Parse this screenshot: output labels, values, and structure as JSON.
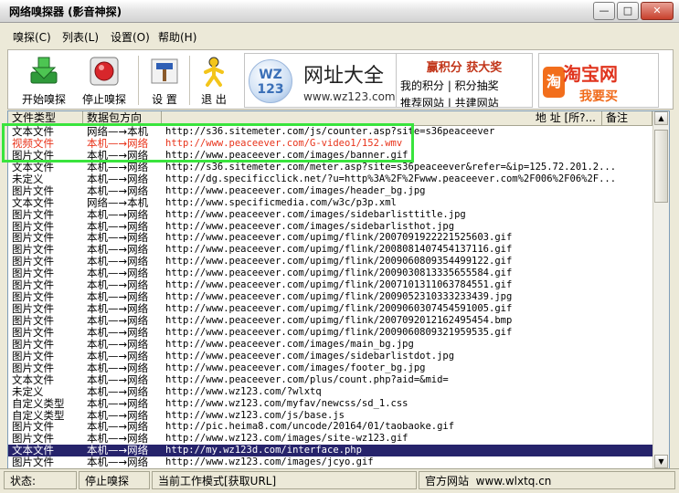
{
  "window": {
    "title": "网络嗅探器 (影音神探)"
  },
  "menu": [
    {
      "label": "嗅探(C)"
    },
    {
      "label": "列表(L)"
    },
    {
      "label": "设置(O)"
    },
    {
      "label": "帮助(H)"
    }
  ],
  "toolbar": {
    "start_label": "开始嗅探",
    "stop_label": "停止嗅探",
    "settings_label": "设 置",
    "exit_label": "退 出"
  },
  "ads": {
    "site_logo": "WZ 123",
    "site_title": "网址大全",
    "site_url": "www.wz123.com",
    "points_title": "赢积分 获大奖",
    "points_a": "我的积分  |  积分抽奖",
    "points_b": "推荐网站  |  共建网站",
    "taobao_icon": "淘",
    "taobao_title": "淘宝网",
    "taobao_sub": "我要买"
  },
  "table": {
    "headers": {
      "type": "文件类型",
      "direction": "数据包方向",
      "address": "地     址  [所?...",
      "note": "备注"
    },
    "rows": [
      {
        "type": "文本文件",
        "direction": "网络—→本机",
        "url": "http://s36.sitemeter.com/js/counter.asp?site=s36peaceever",
        "style": "normal"
      },
      {
        "type": "视频文件",
        "direction": "本机—→网络",
        "url": "http://www.peaceever.com/G-video1/152.wmv",
        "style": "red"
      },
      {
        "type": "图片文件",
        "direction": "本机—→网络",
        "url": "http://www.peaceever.com/images/banner.gif",
        "style": "normal"
      },
      {
        "type": "文本文件",
        "direction": "本机—→网络",
        "url": "http://s36.sitemeter.com/meter.asp?site=s36peaceever&refer=&ip=125.72.201.2...",
        "style": "normal"
      },
      {
        "type": "未定义",
        "direction": "本机—→网络",
        "url": "http://dg.specificclick.net/?u=http%3A%2F%2Fwww.peaceever.com%2F006%2F06%2F...",
        "style": "normal"
      },
      {
        "type": "图片文件",
        "direction": "本机—→网络",
        "url": "http://www.peaceever.com/images/header_bg.jpg",
        "style": "normal"
      },
      {
        "type": "文本文件",
        "direction": "网络—→本机",
        "url": "http://www.specificmedia.com/w3c/p3p.xml",
        "style": "normal"
      },
      {
        "type": "图片文件",
        "direction": "本机—→网络",
        "url": "http://www.peaceever.com/images/sidebarlisttitle.jpg",
        "style": "normal"
      },
      {
        "type": "图片文件",
        "direction": "本机—→网络",
        "url": "http://www.peaceever.com/images/sidebarlisthot.jpg",
        "style": "normal"
      },
      {
        "type": "图片文件",
        "direction": "本机—→网络",
        "url": "http://www.peaceever.com/upimg/flink/2007091922221525603.gif",
        "style": "normal"
      },
      {
        "type": "图片文件",
        "direction": "本机—→网络",
        "url": "http://www.peaceever.com/upimg/flink/2008081407454137116.gif",
        "style": "normal"
      },
      {
        "type": "图片文件",
        "direction": "本机—→网络",
        "url": "http://www.peaceever.com/upimg/flink/2009060809354499122.gif",
        "style": "normal"
      },
      {
        "type": "图片文件",
        "direction": "本机—→网络",
        "url": "http://www.peaceever.com/upimg/flink/2009030813335655584.gif",
        "style": "normal"
      },
      {
        "type": "图片文件",
        "direction": "本机—→网络",
        "url": "http://www.peaceever.com/upimg/flink/2007101311063784551.gif",
        "style": "normal"
      },
      {
        "type": "图片文件",
        "direction": "本机—→网络",
        "url": "http://www.peaceever.com/upimg/flink/2009052310333233439.jpg",
        "style": "normal"
      },
      {
        "type": "图片文件",
        "direction": "本机—→网络",
        "url": "http://www.peaceever.com/upimg/flink/2009060307454591005.gif",
        "style": "normal"
      },
      {
        "type": "图片文件",
        "direction": "本机—→网络",
        "url": "http://www.peaceever.com/upimg/flink/2007092012162495454.bmp",
        "style": "normal"
      },
      {
        "type": "图片文件",
        "direction": "本机—→网络",
        "url": "http://www.peaceever.com/upimg/flink/2009060809321959535.gif",
        "style": "normal"
      },
      {
        "type": "图片文件",
        "direction": "本机—→网络",
        "url": "http://www.peaceever.com/images/main_bg.jpg",
        "style": "normal"
      },
      {
        "type": "图片文件",
        "direction": "本机—→网络",
        "url": "http://www.peaceever.com/images/sidebarlistdot.jpg",
        "style": "normal"
      },
      {
        "type": "图片文件",
        "direction": "本机—→网络",
        "url": "http://www.peaceever.com/images/footer_bg.jpg",
        "style": "normal"
      },
      {
        "type": "文本文件",
        "direction": "本机—→网络",
        "url": "http://www.peaceever.com/plus/count.php?aid=&mid=",
        "style": "normal"
      },
      {
        "type": "未定义",
        "direction": "本机—→网络",
        "url": "http://www.wz123.com/?wlxtq",
        "style": "normal"
      },
      {
        "type": "自定义类型",
        "direction": "本机—→网络",
        "url": "http://www.wz123.com/myfav/newcss/sd_1.css",
        "style": "normal"
      },
      {
        "type": "自定义类型",
        "direction": "本机—→网络",
        "url": "http://www.wz123.com/js/base.js",
        "style": "normal"
      },
      {
        "type": "图片文件",
        "direction": "本机—→网络",
        "url": "http://pic.heima8.com/uncode/20164/01/taobaoke.gif",
        "style": "normal"
      },
      {
        "type": "图片文件",
        "direction": "本机—→网络",
        "url": "http://www.wz123.com/images/site-wz123.gif",
        "style": "normal"
      },
      {
        "type": "文本文件",
        "direction": "本机—→网络",
        "url": "http://my.wz123d.com/interface.php",
        "style": "selected"
      },
      {
        "type": "图片文件",
        "direction": "本机—→网络",
        "url": "http://www.wz123.com/images/jcyo.gif",
        "style": "normal"
      }
    ]
  },
  "status": {
    "label": "状态:",
    "state": "停止嗅探",
    "mode": "当前工作模式[获取URL]",
    "site_label": "官方网站",
    "site_url": "www.wlxtq.cn"
  }
}
